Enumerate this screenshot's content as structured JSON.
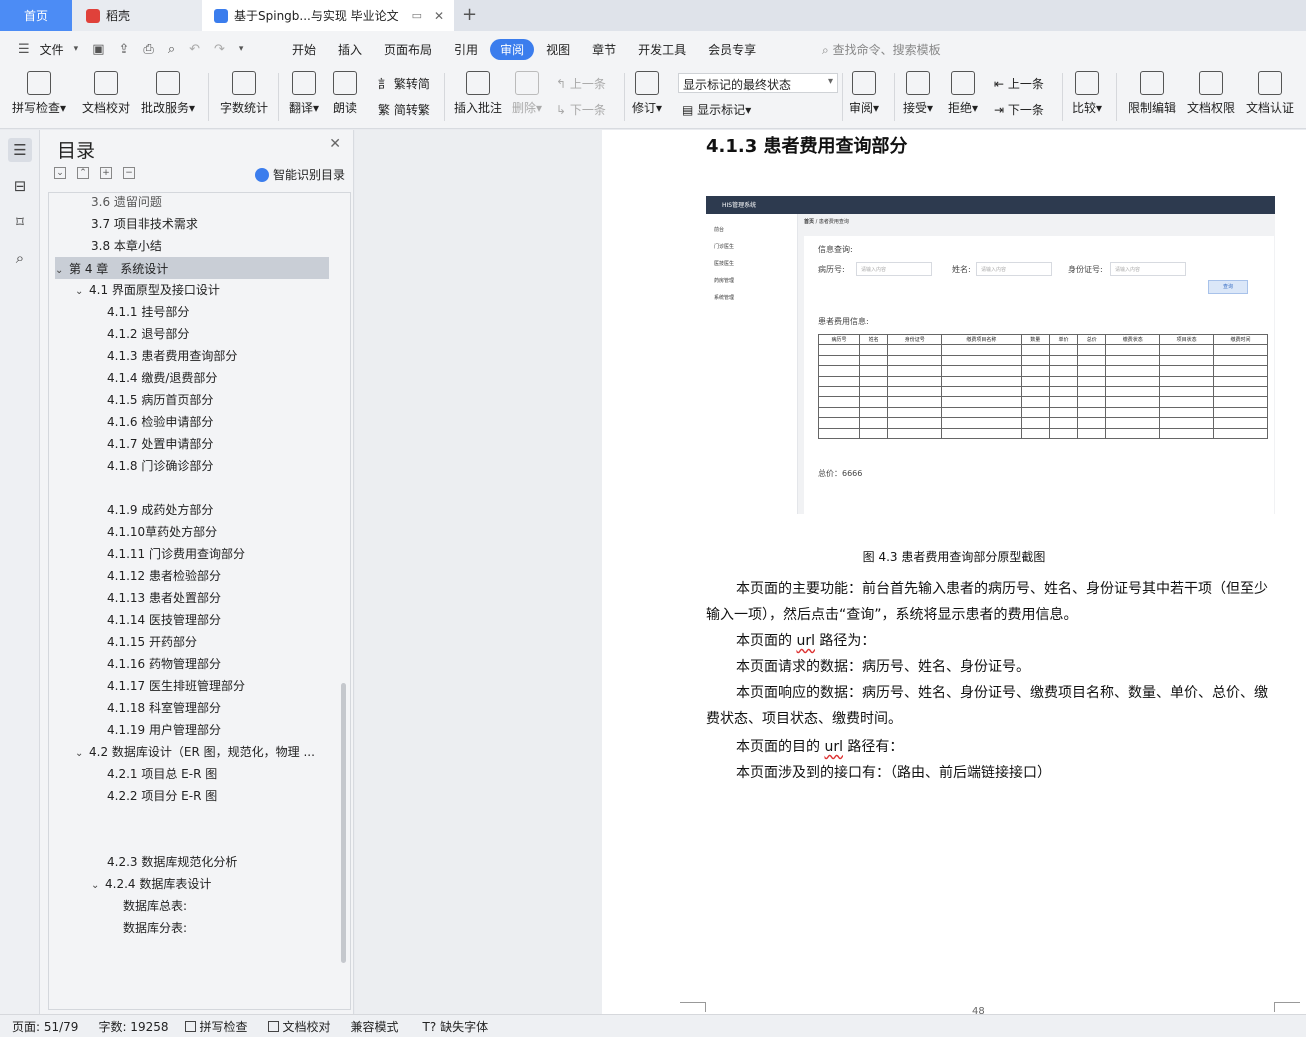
{
  "tabs": {
    "home": "首页",
    "daoke": "稻壳",
    "document": "基于Spingb...与实现 毕业论文"
  },
  "menu": {
    "file": "文件",
    "tabs": [
      "开始",
      "插入",
      "页面布局",
      "引用",
      "审阅",
      "视图",
      "章节",
      "开发工具",
      "会员专享"
    ],
    "active_tab": "审阅",
    "search": "查找命令、搜索模板"
  },
  "ribbon": {
    "spell_check": "拼写检查",
    "doc_proof": "文档校对",
    "revise_service": "批改服务",
    "word_count": "字数统计",
    "translate": "翻译",
    "read_aloud": "朗读",
    "trad_to_simp": "繁转简",
    "simp_to_trad": "简转繁",
    "insert_comment": "插入批注",
    "delete": "删除",
    "prev": "上一条",
    "next": "下一条",
    "track": "修订",
    "markup_state": "显示标记的最终状态",
    "show_markup": "显示标记",
    "review": "审阅",
    "accept": "接受",
    "reject": "拒绝",
    "prev2": "上一条",
    "next2": "下一条",
    "compare": "比较",
    "restrict_edit": "限制编辑",
    "doc_permission": "文档权限",
    "doc_cert": "文档认证"
  },
  "outline": {
    "title": "目录",
    "smart_toc": "智能识别目录",
    "items": [
      {
        "label": "3.6 遗留问题",
        "level": 2
      },
      {
        "label": "3.7 项目非技术需求",
        "level": 2
      },
      {
        "label": "3.8 本章小结",
        "level": 2
      },
      {
        "label": "第 4 章　系统设计",
        "level": 1
      },
      {
        "label": "4.1  界面原型及接口设计",
        "level": 2
      },
      {
        "label": "4.1.1  挂号部分",
        "level": 3
      },
      {
        "label": "4.1.2  退号部分",
        "level": 3
      },
      {
        "label": "4.1.3  患者费用查询部分",
        "level": 3
      },
      {
        "label": "4.1.4  缴费/退费部分",
        "level": 3
      },
      {
        "label": "4.1.5  病历首页部分",
        "level": 3
      },
      {
        "label": "4.1.6  检验申请部分",
        "level": 3
      },
      {
        "label": "4.1.7  处置申请部分",
        "level": 3
      },
      {
        "label": "4.1.8  门诊确诊部分",
        "level": 3
      },
      {
        "label": "4.1.9  成药处方部分",
        "level": 3
      },
      {
        "label": "4.1.10草药处方部分",
        "level": 3
      },
      {
        "label": "4.1.11 门诊费用查询部分",
        "level": 3
      },
      {
        "label": "4.1.12 患者检验部分",
        "level": 3
      },
      {
        "label": "4.1.13 患者处置部分",
        "level": 3
      },
      {
        "label": "4.1.14 医技管理部分",
        "level": 3
      },
      {
        "label": "4.1.15 开药部分",
        "level": 3
      },
      {
        "label": "4.1.16 药物管理部分",
        "level": 3
      },
      {
        "label": "4.1.17 医生排班管理部分",
        "level": 3
      },
      {
        "label": "4.1.18 科室管理部分",
        "level": 3
      },
      {
        "label": "4.1.19 用户管理部分",
        "level": 3
      },
      {
        "label": "4.2  数据库设计（ER 图，规范化，物理 ...",
        "level": 2
      },
      {
        "label": "4.2.1 项目总 E-R 图",
        "level": 3
      },
      {
        "label": "4.2.2 项目分 E-R 图",
        "level": 3
      },
      {
        "label": "4.2.3 数据库规范化分析",
        "level": 3
      },
      {
        "label": "4.2.4 数据库表设计",
        "level": 3
      },
      {
        "label": "数据库总表:",
        "level": 4
      },
      {
        "label": "数据库分表:",
        "level": 4
      }
    ]
  },
  "document": {
    "heading": "4.1.3  患者费用查询部分",
    "figure": {
      "app_title": "HIS管理系统",
      "breadcrumb": [
        "首页",
        "患者费用查询"
      ],
      "sidebar": [
        "前台",
        "门诊医生",
        "医技医生",
        "药房管理",
        "系统管理"
      ],
      "section1": "信息查询:",
      "fields": [
        {
          "label": "病历号:",
          "placeholder": "请输入内容"
        },
        {
          "label": "姓名:",
          "placeholder": "请输入内容"
        },
        {
          "label": "身份证号:",
          "placeholder": "请输入内容"
        }
      ],
      "search_btn": "查询",
      "section2": "患者费用信息:",
      "columns": [
        "病历号",
        "姓名",
        "身份证号",
        "缴费项目名称",
        "数量",
        "单价",
        "总价",
        "缴费状态",
        "项目状态",
        "缴费时间"
      ],
      "total": "总价：6666"
    },
    "caption": "图 4.3 患者费用查询部分原型截图",
    "p1": "本页面的主要功能：前台首先输入患者的病历号、姓名、身份证号其中若干项（但至少输入一项），然后点击“查询”，系统将显示患者的费用信息。",
    "p2a": "本页面的 ",
    "p2url": "url",
    "p2b": " 路径为：",
    "p3": "本页面请求的数据：病历号、姓名、身份证号。",
    "p4": "本页面响应的数据：病历号、姓名、身份证号、缴费项目名称、数量、单价、总价、缴费状态、项目状态、缴费时间。",
    "p5a": "本页面的目的 ",
    "p5url": "url",
    "p5b": " 路径有：",
    "p6": "本页面涉及到的接口有：（路由、前后端链接接口）",
    "page_number": "48"
  },
  "status": {
    "page": "页面: 51/79",
    "words": "字数: 19258",
    "spell": "拼写检查",
    "proof": "文档校对",
    "compat": "兼容模式",
    "missing_font": "缺失字体"
  }
}
